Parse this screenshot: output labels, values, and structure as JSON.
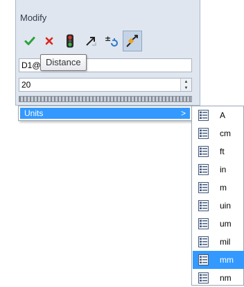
{
  "panel": {
    "title": "Modify",
    "field1_value": "D1@",
    "field2_value": "20"
  },
  "toolbar": {
    "buttons": [
      {
        "icon": "ok-checkmark-icon"
      },
      {
        "icon": "cancel-x-icon"
      },
      {
        "icon": "traffic-light-icon"
      },
      {
        "icon": "arrow-icon"
      },
      {
        "icon": "plus-minus-rebuild-icon"
      },
      {
        "icon": "dimension-marker-icon"
      }
    ]
  },
  "tooltip": {
    "text": "Distance"
  },
  "menu": {
    "item_label": "Units",
    "arrow": ">"
  },
  "submenu": {
    "selected": "mm",
    "items": [
      "A",
      "cm",
      "ft",
      "in",
      "m",
      "uin",
      "um",
      "mil",
      "mm",
      "nm"
    ]
  },
  "colors": {
    "selection": "#3399ff",
    "panel_bg": "#dfe6ef"
  }
}
